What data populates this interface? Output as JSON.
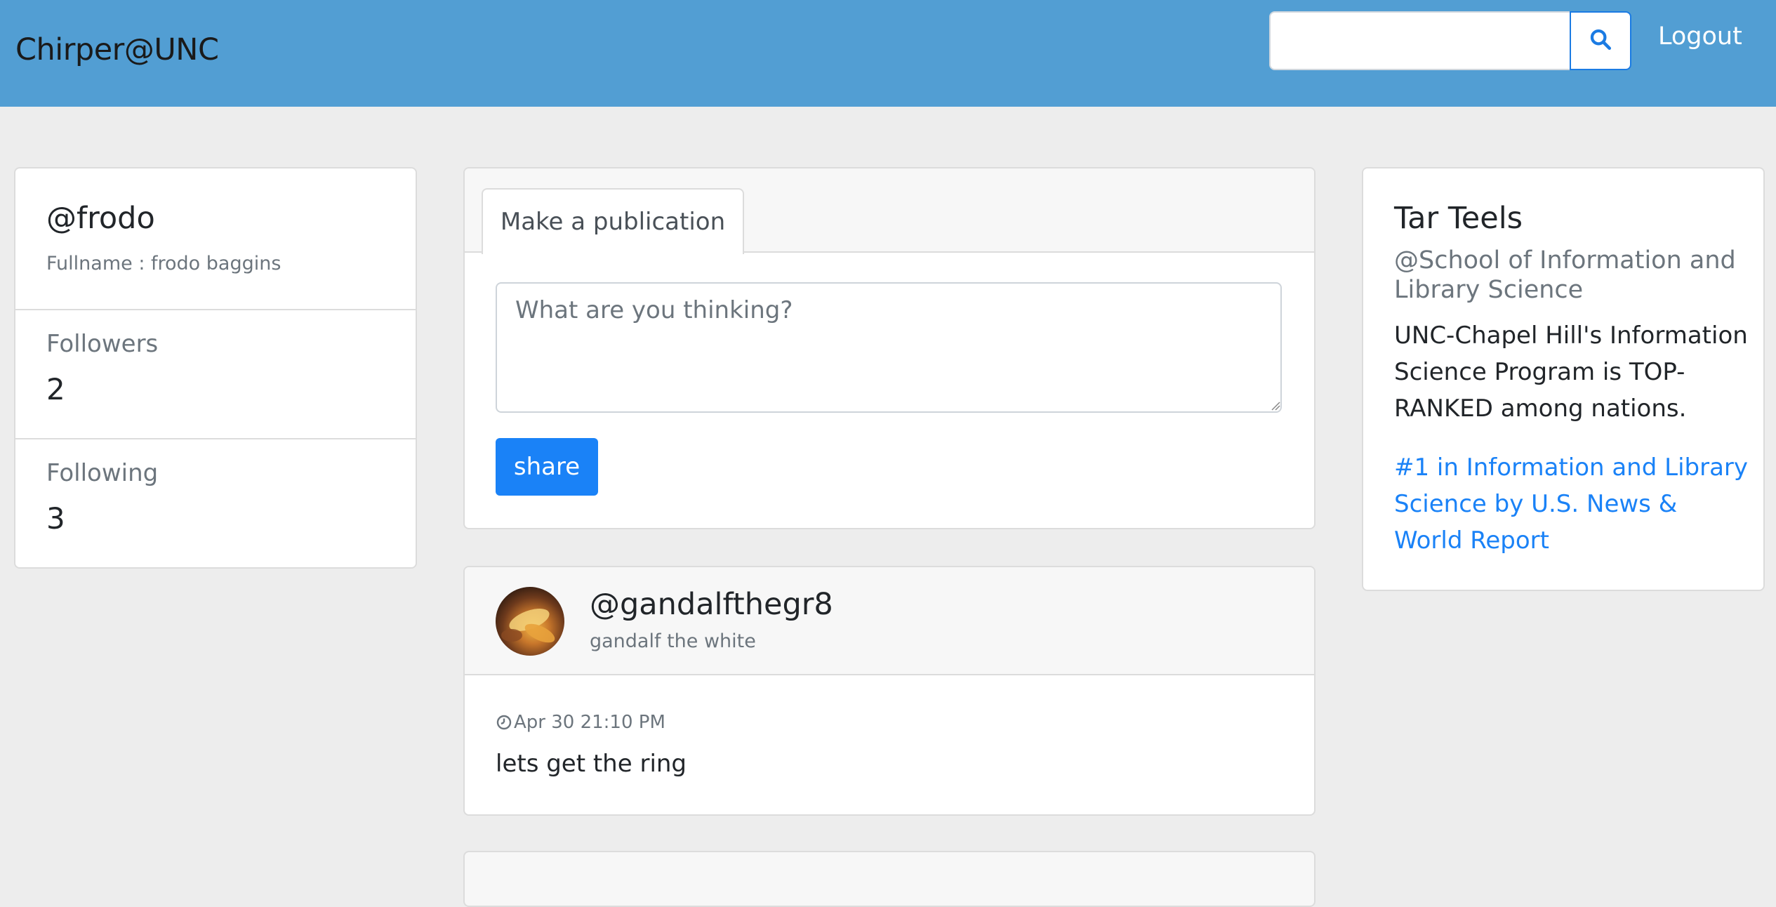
{
  "navbar": {
    "brand": "Chirper@UNC",
    "search_value": "",
    "search_placeholder": "",
    "logout_label": "Logout",
    "background_color": "#529ed3"
  },
  "profile": {
    "handle": "@frodo",
    "fullname": "Fullname : frodo baggins",
    "followers_label": "Followers",
    "followers_count": "2",
    "following_label": "Following",
    "following_count": "3"
  },
  "compose": {
    "tab_label": "Make a publication",
    "textarea_placeholder": "What are you thinking?",
    "share_label": "share",
    "share_color": "#1a82f7"
  },
  "posts": [
    {
      "author_handle": "@gandalfthegr8",
      "author_name": "gandalf the white",
      "timestamp": "Apr 30 21:10 PM",
      "text": "lets get the ring",
      "avatar": "avatar-photo"
    }
  ],
  "trend": {
    "title": "Tar Teels",
    "subtitle": "@School of Information and Library Science",
    "description": "UNC-Chapel Hill's Information Science Program is TOP-RANKED among nations.",
    "link_text": "#1 in Information and Library Science by U.S. News & World Report",
    "link_color": "#1a82f7"
  },
  "icons": {
    "search": "search-icon",
    "clock": "clock-icon"
  }
}
